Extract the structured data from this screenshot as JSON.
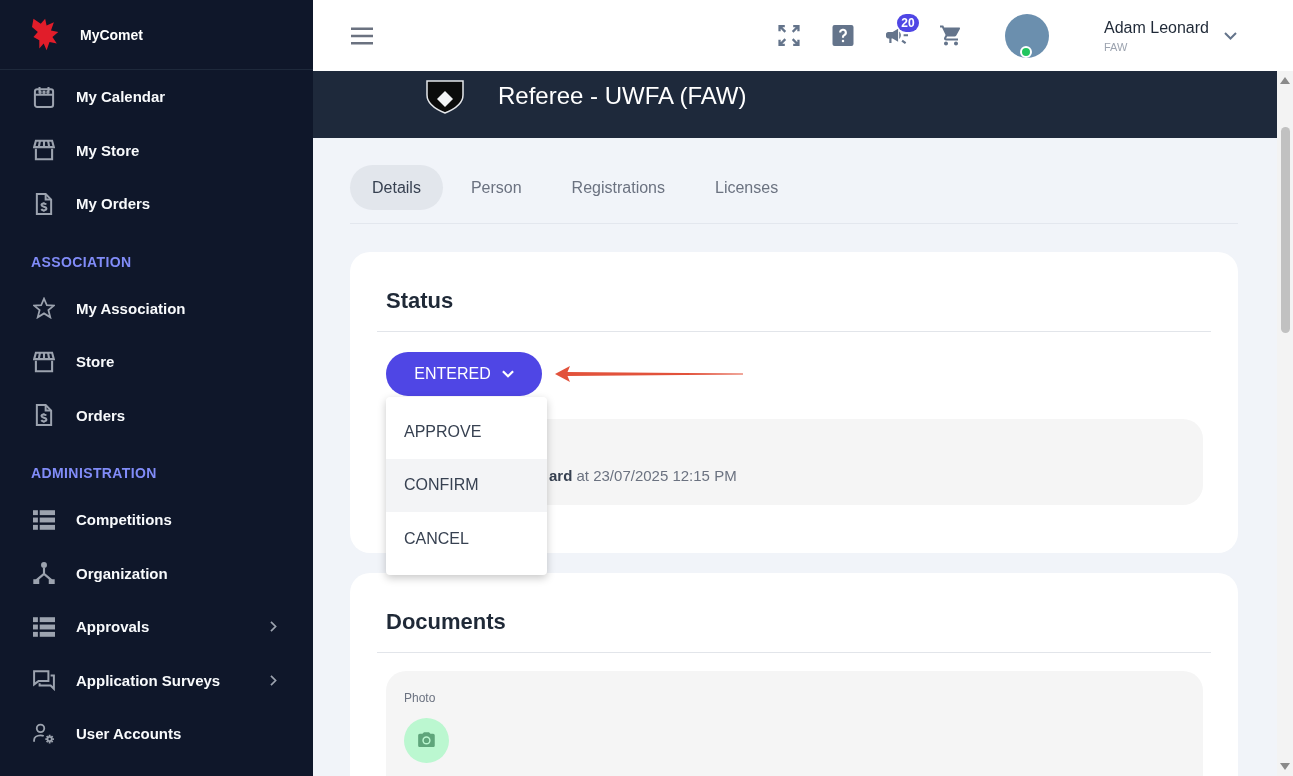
{
  "sidebar": {
    "brand": "MyComet",
    "sections": [
      {
        "items": [
          {
            "label": "My Calendar",
            "expandable": false
          },
          {
            "label": "My Store",
            "expandable": false
          },
          {
            "label": "My Orders",
            "expandable": false
          }
        ]
      },
      {
        "title": "ASSOCIATION",
        "items": [
          {
            "label": "My Association",
            "expandable": false
          },
          {
            "label": "Store",
            "expandable": false
          },
          {
            "label": "Orders",
            "expandable": false
          }
        ]
      },
      {
        "title": "ADMINISTRATION",
        "items": [
          {
            "label": "Competitions",
            "expandable": false
          },
          {
            "label": "Organization",
            "expandable": false
          },
          {
            "label": "Approvals",
            "expandable": true
          },
          {
            "label": "Application Surveys",
            "expandable": true
          },
          {
            "label": "User Accounts",
            "expandable": false
          }
        ]
      }
    ]
  },
  "header": {
    "notification_count": "20",
    "user": {
      "name": "Adam Leonard",
      "organization": "FAW",
      "online": true
    }
  },
  "banner": {
    "title": "Referee - UWFA (FAW)"
  },
  "tabs": [
    {
      "label": "Details",
      "selected": true
    },
    {
      "label": "Person",
      "selected": false
    },
    {
      "label": "Registrations",
      "selected": false
    },
    {
      "label": "Licenses",
      "selected": false
    }
  ],
  "status_card": {
    "title": "Status",
    "status_button": "ENTERED",
    "menu": {
      "open": true,
      "items": [
        {
          "label": "APPROVE",
          "highlighted": false
        },
        {
          "label": "CONFIRM",
          "highlighted": true
        },
        {
          "label": "CANCEL",
          "highlighted": false
        }
      ]
    },
    "history": "**ard** at 23/07/2025 12:15 PM"
  },
  "documents_card": {
    "title": "Documents",
    "fields": [
      {
        "label": "Photo"
      }
    ]
  }
}
